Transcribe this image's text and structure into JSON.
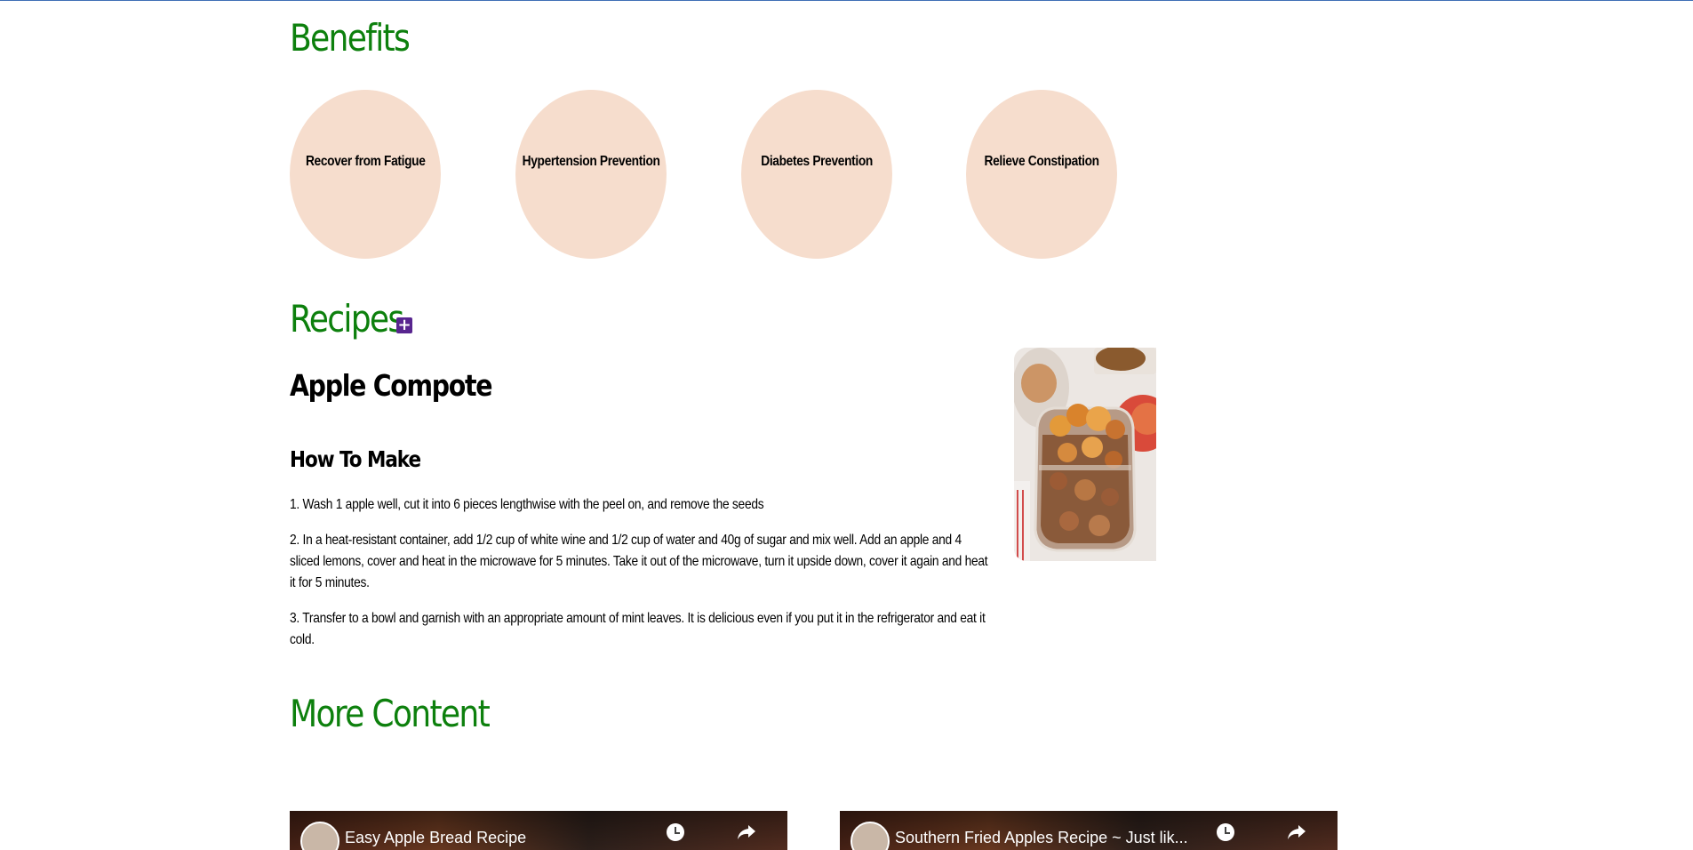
{
  "sections": {
    "benefits": "Benefits",
    "recipes": "Recipes",
    "more_content": "More Content"
  },
  "benefits": [
    "Recover from Fatigue",
    "Hypertension Prevention",
    "Diabetes Prevention",
    "Relieve Constipation"
  ],
  "recipe": {
    "expand_icon": "+",
    "title": "Apple Compote",
    "how_to": "How To Make",
    "steps": [
      "1. Wash 1 apple well, cut it into 6 pieces lengthwise with the peel on, and remove the seeds",
      "2. In a heat-resistant container, add 1/2 cup of white wine and 1/2 cup of water and 40g of sugar and mix well. Add an apple and 4 sliced lemons, cover and heat in the microwave for 5 minutes. Take it out of the microwave, turn it upside down, cover it again and heat it for 5 minutes.",
      "3. Transfer to a bowl and garnish with an appropriate amount of mint leaves. It is delicious even if you put it in the refrigerator and eat it cold."
    ]
  },
  "videos": [
    {
      "title": "Easy Apple Bread Recipe"
    },
    {
      "title": "Southern Fried Apples Recipe ~ Just lik..."
    }
  ],
  "colors": {
    "heading_green": "#0d800d",
    "circle_bg": "#f6ddcd",
    "plus_purple": "#58258f"
  }
}
